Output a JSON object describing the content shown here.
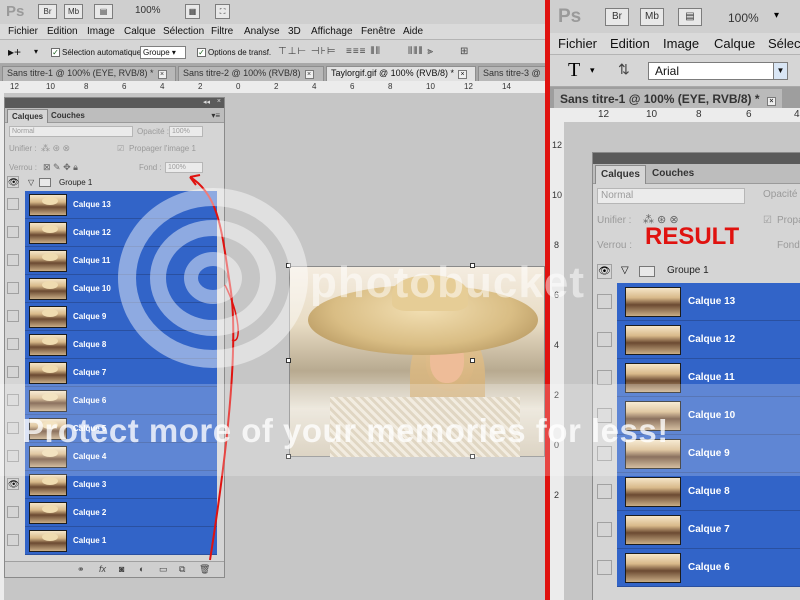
{
  "left": {
    "app_logo": "Ps",
    "app_buttons": [
      "Br",
      "Mb"
    ],
    "zoom": "100%",
    "menu": [
      "Fichier",
      "Edition",
      "Image",
      "Calque",
      "Sélection",
      "Filtre",
      "Analyse",
      "3D",
      "Affichage",
      "Fenêtre",
      "Aide"
    ],
    "options": {
      "auto_select_label": "Sélection automatique :",
      "auto_select_value": "Groupe",
      "transform_label": "Options de transf."
    },
    "tabs": [
      "Sans titre-1 @ 100% (EYE, RVB/8) *",
      "Sans titre-2 @ 100% (RVB/8)",
      "Taylorgif.gif @ 100% (RVB/8) *",
      "Sans titre-3 @"
    ],
    "ruler_marks": [
      "12",
      "10",
      "8",
      "6",
      "4",
      "2",
      "0",
      "2",
      "4",
      "6",
      "8",
      "10",
      "12",
      "14"
    ],
    "panel": {
      "tabs": [
        "Calques",
        "Couches"
      ],
      "blend_mode": "Normal",
      "opacity_label": "Opacité :",
      "opacity_value": "100%",
      "unify_label": "Unifier :",
      "propagate_label": "Propager l'image 1",
      "lock_label": "Verrou :",
      "fill_label": "Fond :",
      "fill_value": "100%",
      "group_name": "Groupe 1",
      "layers": [
        "Calque 13",
        "Calque 12",
        "Calque 11",
        "Calque 10",
        "Calque 9",
        "Calque 8",
        "Calque 7",
        "Calque 6",
        "Calque 5",
        "Calque 4",
        "Calque 3",
        "Calque 2",
        "Calque 1"
      ]
    }
  },
  "right": {
    "app_logo": "Ps",
    "app_buttons": [
      "Br",
      "Mb"
    ],
    "zoom": "100%",
    "menu": [
      "Fichier",
      "Edition",
      "Image",
      "Calque",
      "Sélect"
    ],
    "font_name": "Arial",
    "tab": "Sans titre-1 @ 100% (EYE, RVB/8) *",
    "ruler_marks": [
      "12",
      "10",
      "8",
      "6",
      "4",
      "2",
      "0",
      "2"
    ],
    "result_label": "RESULT",
    "panel": {
      "tabs": [
        "Calques",
        "Couches"
      ],
      "blend_mode": "Normal",
      "opacity_label": "Opacité",
      "unify_label": "Unifier :",
      "propagate_label": "Propa",
      "lock_label": "Verrou :",
      "fill_label": "Fond",
      "group_name": "Groupe 1",
      "layers": [
        "Calque 13",
        "Calque 12",
        "Calque 11",
        "Calque 10",
        "Calque 9",
        "Calque 8",
        "Calque 7",
        "Calque 6"
      ]
    }
  },
  "watermark": {
    "brand": "photobucket",
    "slogan": "Protect more of your memories for less!"
  },
  "colors": {
    "selection_blue": "#3264c8",
    "divider_red": "#e0120f",
    "result_red": "#e0120f"
  }
}
